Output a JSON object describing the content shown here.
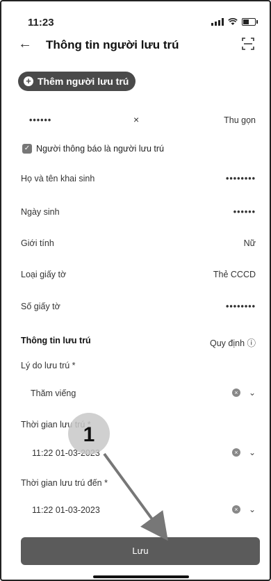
{
  "status": {
    "time": "11:23"
  },
  "header": {
    "title": "Thông tin người lưu trú"
  },
  "actions": {
    "add_label": "Thêm người lưu trú"
  },
  "person": {
    "masked": "••••••",
    "close_glyph": "×",
    "collapse_label": "Thu gọn"
  },
  "checkbox": {
    "label": "Người thông báo là người lưu trú",
    "checked": true
  },
  "info": [
    {
      "label": "Họ và tên khai sinh",
      "value": "••••••••"
    },
    {
      "label": "Ngày sinh",
      "value": "••••••"
    },
    {
      "label": "Giới tính",
      "value": "Nữ"
    },
    {
      "label": "Loại giấy tờ",
      "value": "Thẻ CCCD"
    },
    {
      "label": "Số giấy tờ",
      "value": "••••••••"
    }
  ],
  "stay": {
    "section_title": "Thông tin lưu trú",
    "rules_label": "Quy định ⓘ",
    "reason_label": "Lý do lưu trú *",
    "reason_value": "Thăm viếng",
    "from_label": "Thời gian lưu trú *",
    "from_value": "11:22 01-03-2023",
    "to_label": "Thời gian lưu trú đến *",
    "to_value": "11:22 01-03-2023"
  },
  "footer": {
    "save_label": "Lưu"
  },
  "annotation": {
    "step_number": "1"
  }
}
